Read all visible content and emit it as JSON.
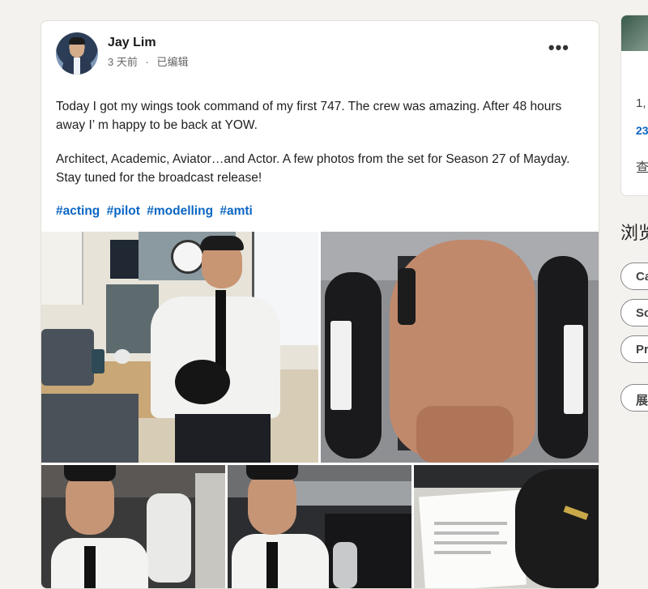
{
  "post": {
    "author": "Jay Lim",
    "time": "3 天前",
    "edited": "已编辑",
    "meta_sep": "·",
    "more_label": "•••",
    "paragraph1": "Today I got my wings took command of my first 747. The crew was amazing. After 48 hours away I’ m happy to be back at YOW.",
    "paragraph2": "Architect, Academic, Aviator…and Actor. A few photos from the set for Season 27 of Mayday. Stay tuned for the broadcast release!",
    "hashtags": [
      "#acting",
      "#pilot",
      "#modelling",
      "#amti"
    ]
  },
  "sidebar": {
    "line1": "1,",
    "line2": "23",
    "line3": "查",
    "browse_title": "浏览",
    "pills": [
      "Ca",
      "Sc",
      "Pr",
      "展"
    ]
  },
  "colors": {
    "link": "#0a66c2",
    "background": "#f4f2ee",
    "card": "#ffffff"
  }
}
